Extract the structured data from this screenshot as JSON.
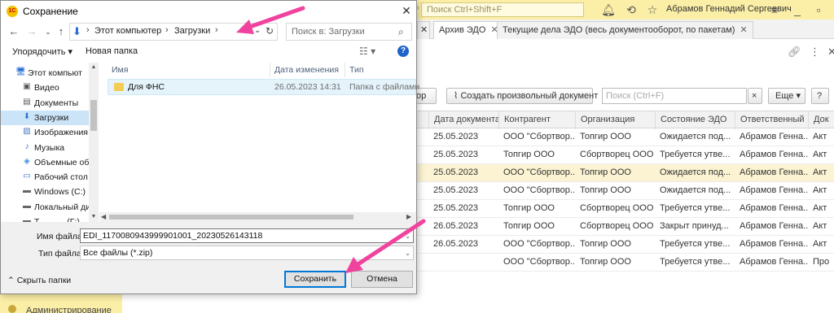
{
  "app": {
    "search_placeholder": "Поиск Ctrl+Shift+F",
    "user_name": "Абрамов Геннадий Сергеевич",
    "tabs": [
      {
        "label": "Архив ЭДО",
        "active": true
      },
      {
        "label": "Текущие дела ЭДО (весь документооборот, по пакетам)",
        "active": false
      }
    ],
    "toolbar": {
      "partial_button": "ор",
      "create_doc_button": "Создать произвольный документ",
      "search_placeholder": "Поиск (Ctrl+F)",
      "search_clear": "×",
      "more_button": "Еще",
      "help_button": "?"
    },
    "grid": {
      "columns": [
        "Дата документа",
        "Контрагент",
        "Организация",
        "Состояние ЭДО",
        "Ответственный",
        "Док"
      ],
      "rows": [
        [
          "25.05.2023",
          "ООО \"Сбортвор...",
          "Топгир ООО",
          "Ожидается под...",
          "Абрамов Генна...",
          "Акт"
        ],
        [
          "25.05.2023",
          "Топгир ООО",
          "Сбортворец ООО",
          "Требуется утве...",
          "Абрамов Генна...",
          "Акт"
        ],
        [
          "25.05.2023",
          "ООО \"Сбортвор...",
          "Топгир ООО",
          "Ожидается под...",
          "Абрамов Генна...",
          "Акт"
        ],
        [
          "25.05.2023",
          "ООО \"Сбортвор...",
          "Топгир ООО",
          "Ожидается под...",
          "Абрамов Генна...",
          "Акт"
        ],
        [
          "25.05.2023",
          "Топгир ООО",
          "Сбортворец ООО",
          "Требуется утве...",
          "Абрамов Генна...",
          "Акт"
        ],
        [
          "26.05.2023",
          "Топгир ООО",
          "Сбортворец ООО",
          "Закрыт принуд...",
          "Абрамов Генна...",
          "Акт"
        ],
        [
          "26.05.2023",
          "ООО \"Сбортвор...",
          "Топгир ООО",
          "Требуется утве...",
          "Абрамов Генна...",
          "Акт"
        ],
        [
          "",
          "ООО \"Сбортвор...",
          "Топгир ООО",
          "Требуется утве...",
          "Абрамов Генна...",
          "Про"
        ]
      ],
      "selected_row": 2
    },
    "sidebar_bottom_label": "Администрирование"
  },
  "dialog": {
    "title": "Сохранение",
    "logo_text": "1С",
    "close": "✕",
    "address": {
      "crumbs": [
        "Этот компьютер",
        "Загрузки"
      ],
      "separator": "›"
    },
    "search_placeholder": "Поиск в: Загрузки",
    "commands": {
      "organize": "Упорядочить ▾",
      "new_folder": "Новая папка"
    },
    "tree": {
      "items": [
        {
          "label": "Этот компьютер",
          "icon": "computer-icon"
        },
        {
          "label": "Видео",
          "icon": "video-icon"
        },
        {
          "label": "Документы",
          "icon": "documents-icon"
        },
        {
          "label": "Загрузки",
          "icon": "downloads-icon",
          "selected": true
        },
        {
          "label": "Изображения",
          "icon": "pictures-icon"
        },
        {
          "label": "Музыка",
          "icon": "music-icon"
        },
        {
          "label": "Объемные объ",
          "icon": "3d-objects-icon"
        },
        {
          "label": "Рабочий стол",
          "icon": "desktop-icon"
        },
        {
          "label": "Windows (C:)",
          "icon": "drive-icon"
        },
        {
          "label": "Локальный дис",
          "icon": "drive-icon"
        },
        {
          "label": "Т... ... ... (Г:)",
          "icon": "drive-icon"
        }
      ]
    },
    "files": {
      "columns": [
        "Имя",
        "Дата изменения",
        "Тип"
      ],
      "rows": [
        {
          "name": "Для ФНС",
          "date": "26.05.2023 14:31",
          "type": "Папка с файлами"
        }
      ]
    },
    "form": {
      "filename_label": "Имя файла:",
      "filename_value": "EDI_1170080943999901001_20230526143118",
      "filetype_label": "Тип файла:",
      "filetype_value": "Все файлы (*.zip)",
      "hide_folders": "Скрыть папки",
      "save_button": "Сохранить",
      "cancel_button": "Отмена"
    }
  },
  "colors": {
    "app_header": "#fbeea6",
    "arrow": "#f0439e",
    "primary_border": "#0078d7",
    "selected_tree": "#cce4f7",
    "selected_row": "#fbf3d2"
  }
}
